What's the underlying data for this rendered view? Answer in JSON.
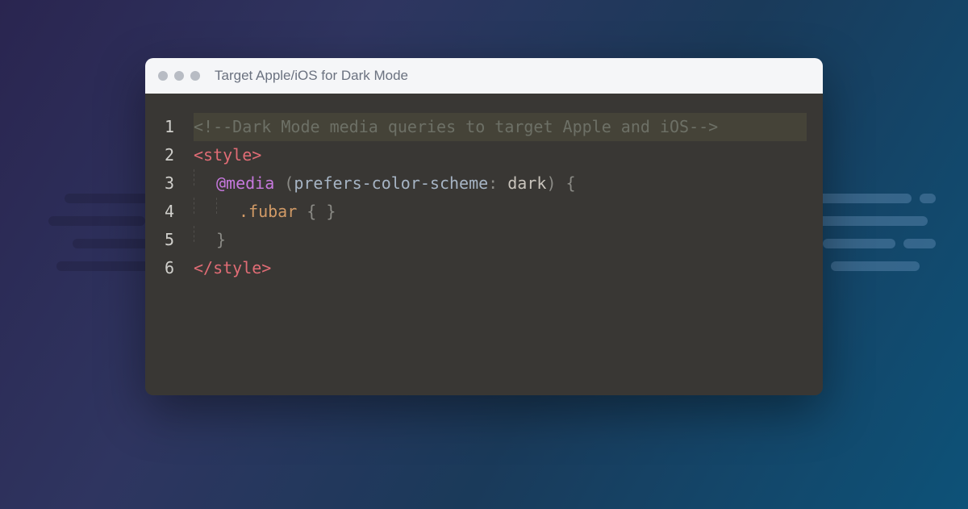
{
  "window": {
    "title": "Target Apple/iOS for Dark Mode"
  },
  "code": {
    "line_numbers": [
      "1",
      "2",
      "3",
      "4",
      "5",
      "6"
    ],
    "line1_comment": "<!--Dark Mode media queries to target Apple and iOS-->",
    "line2_open_tag": "<style>",
    "line3_atrule": "@media",
    "line3_open_paren": "(",
    "line3_property": "prefers-color-scheme",
    "line3_colon": ":",
    "line3_value": " dark",
    "line3_close_paren": ")",
    "line3_brace_open": " {",
    "line4_selector": ".fubar",
    "line4_braces": " { }",
    "line5_brace_close": "}",
    "line6_close_tag": "</style>"
  }
}
